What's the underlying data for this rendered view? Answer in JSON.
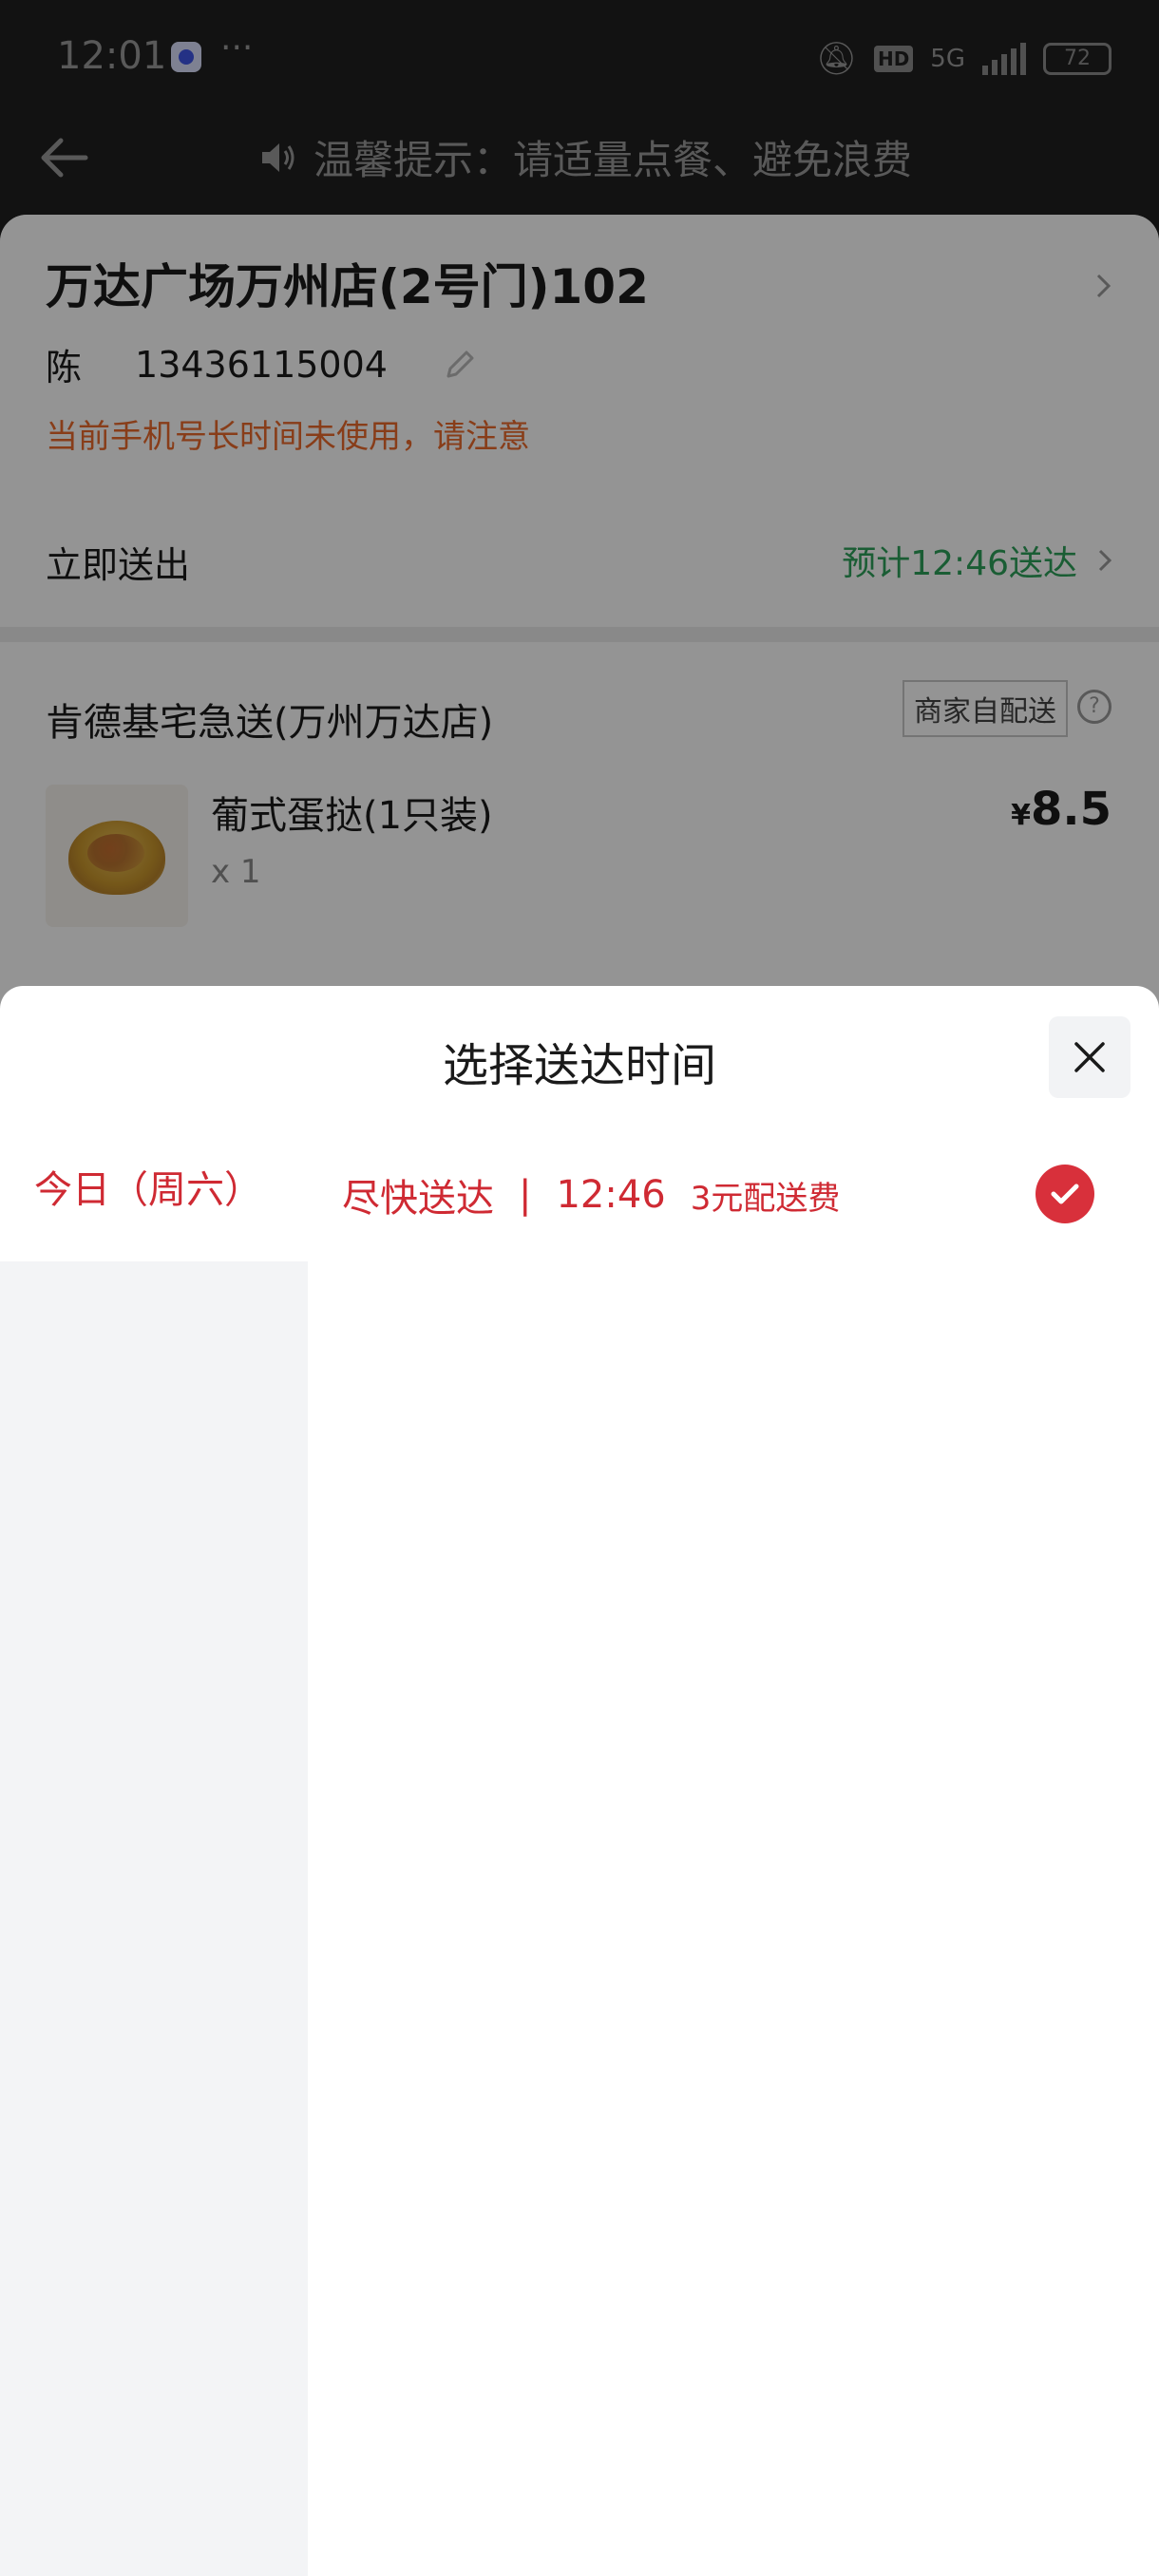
{
  "status_bar": {
    "time": "12:01",
    "dots": "···",
    "hd": "HD",
    "network": "5G",
    "battery": "72"
  },
  "header": {
    "tip": "温馨提示：请适量点餐、避免浪费"
  },
  "address": {
    "title": "万达广场万州店(2号门)102",
    "name": "陈",
    "phone": "13436115004",
    "warning": "当前手机号长时间未使用，请注意"
  },
  "delivery": {
    "label": "立即送出",
    "eta": "预计12:46送达"
  },
  "shop": {
    "name": "肯德基宅急送(万州万达店)",
    "tag": "商家自配送",
    "help": "?"
  },
  "items": [
    {
      "name": "葡式蛋挞(1只装)",
      "qty": "x 1",
      "currency": "¥",
      "price": "8.5"
    }
  ],
  "sheet": {
    "title": "选择送达时间",
    "days": [
      {
        "label": "今日（周六）",
        "selected": true
      }
    ],
    "times": [
      {
        "label": "尽快送达",
        "separator": "|",
        "time": "12:46",
        "fee": "3元配送费",
        "selected": true
      }
    ]
  },
  "colors": {
    "accent_red": "#cf2a33",
    "eta_green": "#2ea05a",
    "warning_orange": "#ea6a2c"
  }
}
